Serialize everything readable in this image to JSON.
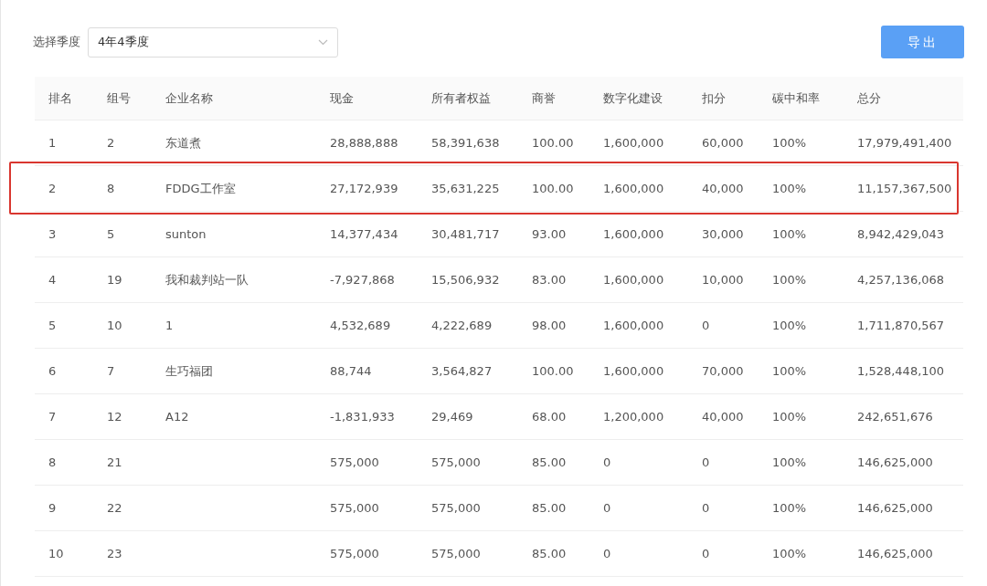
{
  "filter": {
    "label": "选择季度",
    "value": "4年4季度"
  },
  "export_button": "导出",
  "table": {
    "columns": [
      "排名",
      "组号",
      "企业名称",
      "现金",
      "所有者权益",
      "商誉",
      "数字化建设",
      "扣分",
      "碳中和率",
      "总分"
    ],
    "rows": [
      {
        "highlighted": false,
        "cells": [
          "1",
          "2",
          "东道煮",
          "28,888,888",
          "58,391,638",
          "100.00",
          "1,600,000",
          "60,000",
          "100%",
          "17,979,491,400"
        ]
      },
      {
        "highlighted": true,
        "cells": [
          "2",
          "8",
          "FDDG工作室",
          "27,172,939",
          "35,631,225",
          "100.00",
          "1,600,000",
          "40,000",
          "100%",
          "11,157,367,500"
        ]
      },
      {
        "highlighted": false,
        "cells": [
          "3",
          "5",
          "sunton",
          "14,377,434",
          "30,481,717",
          "93.00",
          "1,600,000",
          "30,000",
          "100%",
          "8,942,429,043"
        ]
      },
      {
        "highlighted": false,
        "cells": [
          "4",
          "19",
          "我和裁判站一队",
          "-7,927,868",
          "15,506,932",
          "83.00",
          "1,600,000",
          "10,000",
          "100%",
          "4,257,136,068"
        ]
      },
      {
        "highlighted": false,
        "cells": [
          "5",
          "10",
          "1",
          "4,532,689",
          "4,222,689",
          "98.00",
          "1,600,000",
          "0",
          "100%",
          "1,711,870,567"
        ]
      },
      {
        "highlighted": false,
        "cells": [
          "6",
          "7",
          "生巧福团",
          "88,744",
          "3,564,827",
          "100.00",
          "1,600,000",
          "70,000",
          "100%",
          "1,528,448,100"
        ]
      },
      {
        "highlighted": false,
        "cells": [
          "7",
          "12",
          "A12",
          "-1,831,933",
          "29,469",
          "68.00",
          "1,200,000",
          "40,000",
          "100%",
          "242,651,676"
        ]
      },
      {
        "highlighted": false,
        "cells": [
          "8",
          "21",
          null,
          "575,000",
          "575,000",
          "85.00",
          "0",
          "0",
          "100%",
          "146,625,000"
        ]
      },
      {
        "highlighted": false,
        "cells": [
          "9",
          "22",
          null,
          "575,000",
          "575,000",
          "85.00",
          "0",
          "0",
          "100%",
          "146,625,000"
        ]
      },
      {
        "highlighted": false,
        "cells": [
          "10",
          "23",
          null,
          "575,000",
          "575,000",
          "85.00",
          "0",
          "0",
          "100%",
          "146,625,000"
        ]
      }
    ]
  }
}
